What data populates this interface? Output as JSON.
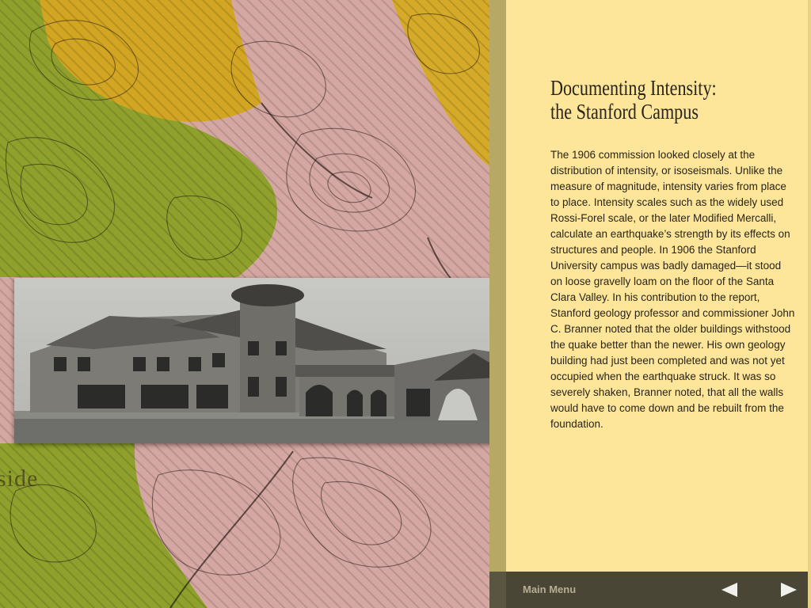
{
  "article": {
    "title_line1": "Documenting Intensity:",
    "title_line2": "the Stanford Campus",
    "body": "The 1906 commission looked closely at the distribution of intensity, or isoseismals. Unlike the measure of magnitude, intensity varies from place to place. Intensity scales such as the widely used Rossi-Forel scale, or the later Modified Mercalli, calculate an earthquake’s strength by its effects on structures and people. In 1906 the Stanford University campus was badly damaged—it stood on loose gravelly loam on the floor of the Santa Clara Valley. In his contribution to the report, Stanford geology professor and commissioner John C. Branner noted that the older buildings withstood the quake better than the newer. His own geology building had just been completed and was not yet occupied when the earthquake struck. It was so severely shaken, Branner noted, that all the walls would have to come down and be rebuilt from the foundation."
  },
  "map": {
    "fragment_label": "side"
  },
  "navigation": {
    "main_menu_label": "Main Menu",
    "prev_icon": "triangle-left-icon",
    "next_icon": "triangle-right-icon"
  },
  "colors": {
    "panel_bg": "#fde69a",
    "map_pink": "#d9a9a4",
    "map_green": "#8ca02a",
    "map_yellow": "#d4a820",
    "bottom_bar": "#4a4636"
  }
}
